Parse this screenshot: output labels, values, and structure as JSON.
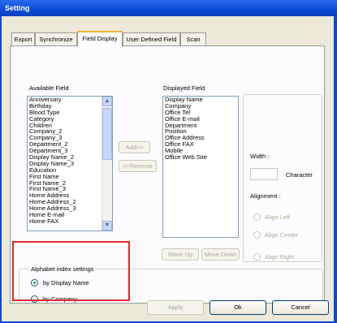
{
  "window": {
    "title": "Setting"
  },
  "tabs": [
    "Export",
    "Synchronize",
    "Field Display",
    "User Defined Field",
    "Scan"
  ],
  "available": {
    "label": "Available Field",
    "items": [
      "Anniversary",
      "Birthday",
      "Blood Type",
      "Category",
      "Children",
      "Company_2",
      "Company_3",
      "Department_2",
      "Department_3",
      "Display Name_2",
      "Display Name_3",
      "Education",
      "First Name",
      "First Name_2",
      "First Name_3",
      "Home Address",
      "Home Address_2",
      "Home Address_3",
      "Home E-mail",
      "Home FAX"
    ]
  },
  "displayed": {
    "label": "Displayed Field",
    "items": [
      "Display Name",
      "Company",
      "Office Tel",
      "Office E-mail",
      "Department",
      "Position",
      "Office Address",
      "Office FAX",
      "Mobile",
      "Office Web Site"
    ]
  },
  "buttons": {
    "add": "Add>>",
    "remove": "<<Remove",
    "move_up": "Move Up",
    "move_down": "Move Down",
    "apply": "Apply",
    "ok": "Ok",
    "cancel": "Cancel"
  },
  "props": {
    "width_label": "Width :",
    "character": "Character",
    "alignment_label": "Alignment :",
    "align_left": "Align Left",
    "align_center": "Align Center",
    "align_right": "Align Right"
  },
  "alpha": {
    "label": "Alphabet index settings",
    "by_display_name": "by Display Name",
    "by_company": "by Company",
    "selected": "by Display Name"
  },
  "colors": {
    "title_bar": "#0b4ad6",
    "highlight": "#e8262a",
    "dialog_bg": "#ece9d8"
  }
}
